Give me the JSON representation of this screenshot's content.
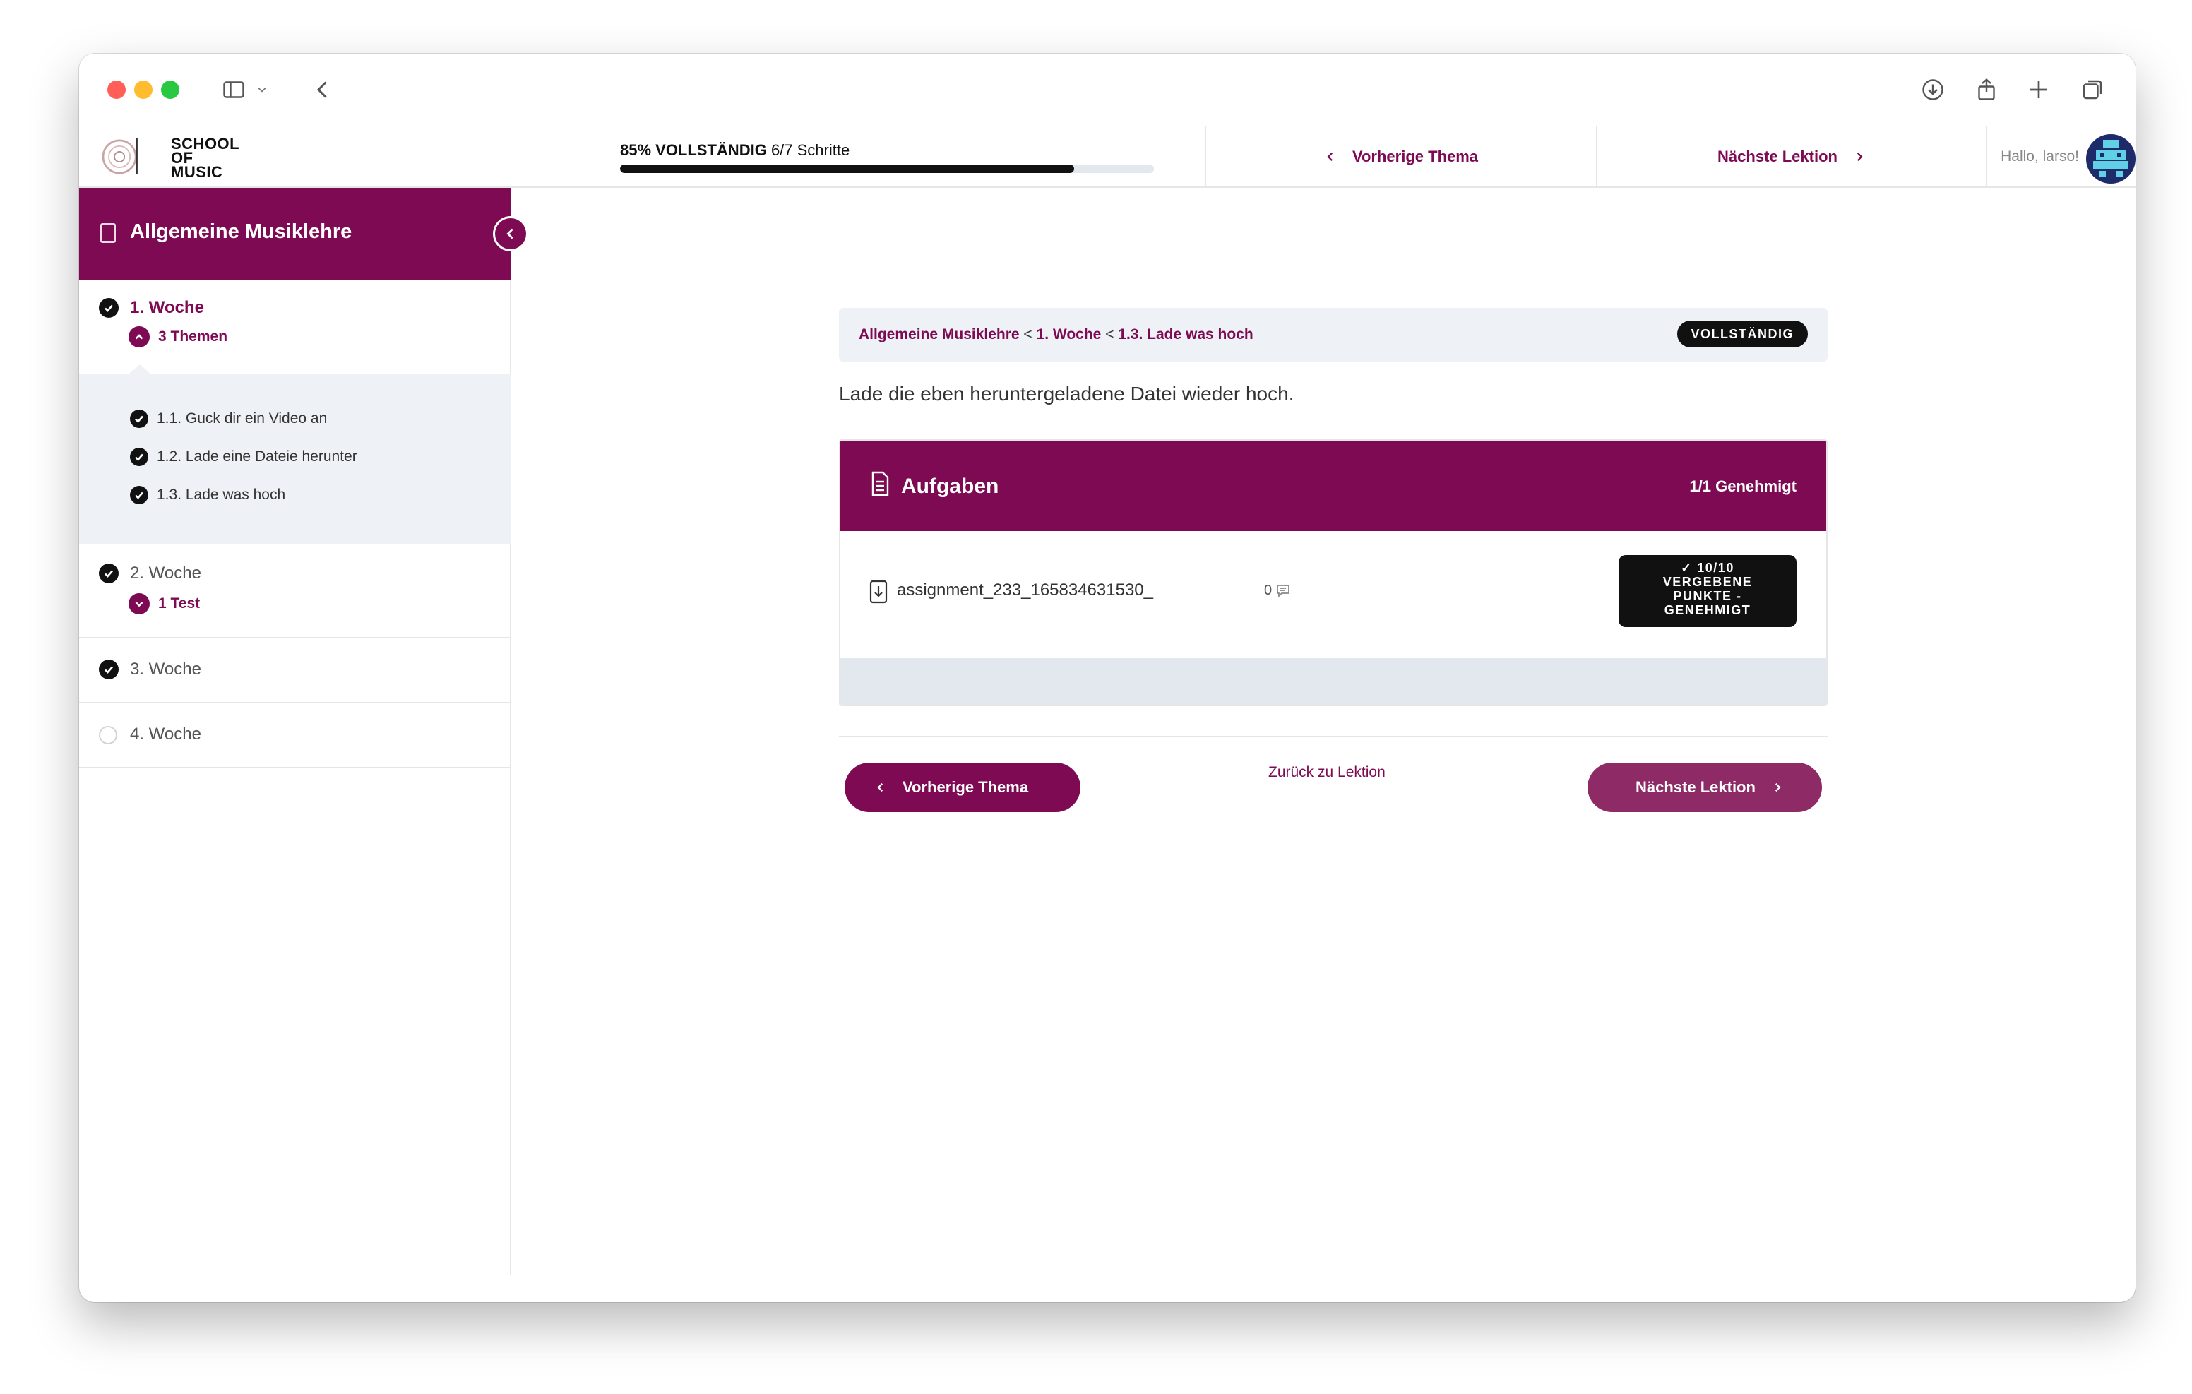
{
  "header": {
    "logo_text_line1": "SCHOOL",
    "logo_text_line2": "OF",
    "logo_text_line3": "MUSIC",
    "progress_percent_label": "85% VOLLSTÄNDIG",
    "progress_steps": "6/7 Schritte",
    "progress_fraction": 0.85,
    "prev_topic": "Vorherige Thema",
    "next_lesson": "Nächste Lektion",
    "greeting": "Hallo, larso!"
  },
  "sidebar": {
    "course_title": "Allgemeine Musiklehre",
    "weeks": [
      {
        "label": "1. Woche",
        "toggle": "3 Themen",
        "status": "complete"
      },
      {
        "label": "2. Woche",
        "toggle": "1 Test",
        "status": "complete"
      },
      {
        "label": "3. Woche",
        "status": "complete"
      },
      {
        "label": "4. Woche",
        "status": "incomplete"
      }
    ],
    "topics": [
      "1.1. Guck dir ein Video an",
      "1.2. Lade eine Dateie herunter",
      "1.3. Lade was hoch"
    ]
  },
  "main": {
    "breadcrumb": [
      "Allgemeine Musiklehre",
      "1. Woche",
      "1.3. Lade was hoch"
    ],
    "breadcrumb_sep": "<",
    "status_badge": "VOLLSTÄNDIG",
    "description": "Lade die eben heruntergeladene Datei wieder hoch.",
    "tasks": {
      "title": "Aufgaben",
      "count": "1/1 Genehmigt",
      "file_name": "assignment_233_165834631530_",
      "comment_count": "0",
      "points_line1": "10/10",
      "points_line2": "VERGEBENE",
      "points_line3": "PUNKTE -",
      "points_line4": "GENEHMIGT"
    },
    "prev_button": "Vorherige Thema",
    "back_link": "Zurück zu Lektion",
    "next_button": "Nächste Lektion"
  },
  "colors": {
    "brand": "#7d0a52",
    "dark": "#111111",
    "panel": "#eef1f5"
  }
}
